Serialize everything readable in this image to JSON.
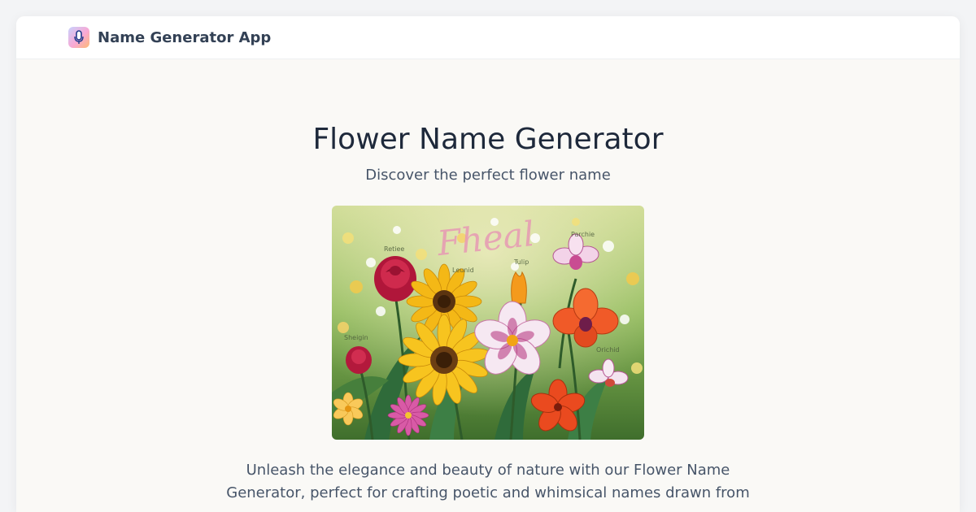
{
  "navbar": {
    "app_name": "Name Generator App",
    "logo_icon": "microphone-logo-icon"
  },
  "hero": {
    "title": "Flower Name Generator",
    "subtitle": "Discover the perfect flower name",
    "image_script_text": "Fheal",
    "image_flower_labels": [
      "Retiee",
      "Leunid",
      "Tulip",
      "Parchie",
      "Sheigin",
      "Orichid"
    ]
  },
  "description": "Unleash the elegance and beauty of nature with our Flower Name Generator, perfect for crafting poetic and whimsical names drawn from",
  "colors": {
    "page_background": "#faf9f6",
    "title": "#1e293b",
    "body_text": "#475569"
  }
}
